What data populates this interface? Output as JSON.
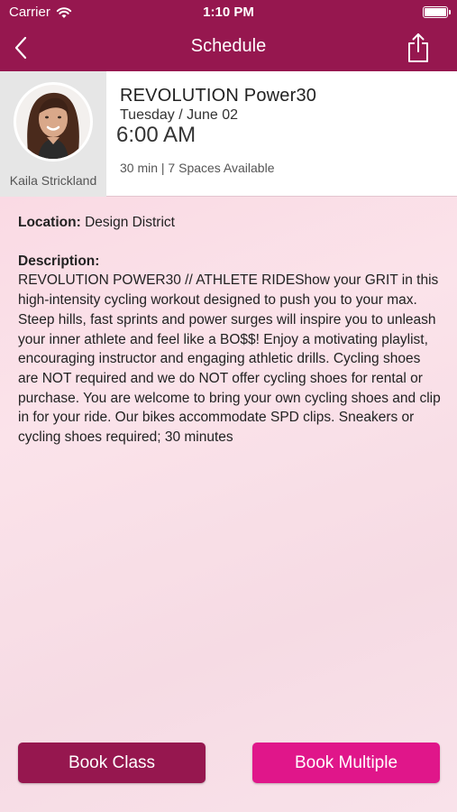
{
  "status_bar": {
    "carrier": "Carrier",
    "time": "1:10 PM",
    "wifi_icon": "wifi-icon",
    "battery_icon": "battery-icon"
  },
  "nav": {
    "title": "Schedule",
    "back_icon": "chevron-left-icon",
    "share_icon": "share-icon"
  },
  "class": {
    "title": "REVOLUTION Power30",
    "date": "Tuesday / June 02",
    "time": "6:00 AM",
    "meta": "30 min | 7 Spaces Available",
    "instructor": "Kaila Strickland"
  },
  "details": {
    "location_label": "Location:",
    "location_value": "Design District",
    "description_label": "Description:",
    "description": "REVOLUTION POWER30 // ATHLETE RIDEShow your GRIT in this high-intensity cycling workout designed to push you to your max. Steep hills, fast sprints and power surges will inspire you to unleash your inner athlete and feel like a BO$$! Enjoy a motivating playlist, encouraging instructor and engaging athletic drills. Cycling shoes are NOT required and we do NOT offer cycling shoes for rental or purchase. You are welcome to bring your own cycling shoes and clip in for your ride. Our bikes accommodate SPD clips. Sneakers or cycling shoes required; 30 minutes"
  },
  "actions": {
    "book_class": "Book Class",
    "book_multiple": "Book Multiple"
  },
  "colors": {
    "brand": "#96174f",
    "accent": "#e0168a"
  }
}
